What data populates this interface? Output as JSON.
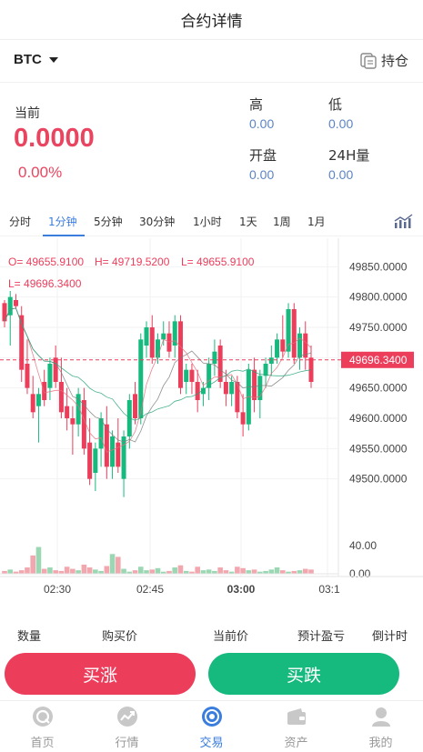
{
  "header": {
    "title": "合约详情"
  },
  "symbol": {
    "name": "BTC",
    "holdings_label": "持仓"
  },
  "price": {
    "current_label": "当前",
    "current": "0.0000",
    "change_pct": "0.00%",
    "high_label": "高",
    "high": "0.00",
    "low_label": "低",
    "low": "0.00",
    "open_label": "开盘",
    "open": "0.00",
    "volume_label": "24H量",
    "volume": "0.00"
  },
  "periods": [
    "分时",
    "1分钟",
    "5分钟",
    "30分钟",
    "1小时",
    "1天",
    "1周",
    "1月"
  ],
  "active_period": "1分钟",
  "chart_data": {
    "type": "candlestick",
    "ohlc_label": {
      "o": "O= 49655.9100",
      "h": "H= 49719.5200",
      "l": "L= 49655.9100",
      "c": "L= 49696.3400"
    },
    "y_ticks": [
      "49850.0000",
      "49800.0000",
      "49750.0000",
      "49700.0000",
      "49650.0000",
      "49600.0000",
      "49550.0000",
      "49500.0000"
    ],
    "ylim": [
      49450,
      49870
    ],
    "current_price_tag": "49696.3400",
    "current_price": 49696.34,
    "volume_ticks": [
      "40.00",
      "0.00"
    ],
    "x_ticks": [
      "02:30",
      "02:45",
      "03:00",
      "03:1"
    ],
    "candles": [
      [
        49790,
        49795,
        49750,
        49760
      ],
      [
        49770,
        49810,
        49720,
        49800
      ],
      [
        49795,
        49805,
        49780,
        49785
      ],
      [
        49770,
        49785,
        49660,
        49680
      ],
      [
        49690,
        49730,
        49640,
        49650
      ],
      [
        49640,
        49670,
        49600,
        49610
      ],
      [
        49620,
        49650,
        49560,
        49640
      ],
      [
        49660,
        49680,
        49620,
        49630
      ],
      [
        49650,
        49700,
        49630,
        49690
      ],
      [
        49700,
        49720,
        49650,
        49660
      ],
      [
        49660,
        49700,
        49600,
        49610
      ],
      [
        49620,
        49650,
        49580,
        49600
      ],
      [
        49600,
        49620,
        49540,
        49590
      ],
      [
        49590,
        49650,
        49570,
        49640
      ],
      [
        49630,
        49650,
        49540,
        49550
      ],
      [
        49560,
        49600,
        49490,
        49500
      ],
      [
        49510,
        49560,
        49480,
        49550
      ],
      [
        49550,
        49610,
        49520,
        49600
      ],
      [
        49590,
        49620,
        49500,
        49520
      ],
      [
        49520,
        49580,
        49500,
        49570
      ],
      [
        49560,
        49600,
        49510,
        49520
      ],
      [
        49500,
        49580,
        49470,
        49570
      ],
      [
        49570,
        49640,
        49550,
        49630
      ],
      [
        49640,
        49660,
        49590,
        49600
      ],
      [
        49600,
        49740,
        49590,
        49730
      ],
      [
        49720,
        49760,
        49700,
        49750
      ],
      [
        49750,
        49770,
        49690,
        49700
      ],
      [
        49700,
        49740,
        49690,
        49730
      ],
      [
        49730,
        49760,
        49720,
        49740
      ],
      [
        49740,
        49760,
        49700,
        49710
      ],
      [
        49720,
        49770,
        49700,
        49760
      ],
      [
        49760,
        49770,
        49640,
        49650
      ],
      [
        49660,
        49690,
        49640,
        49680
      ],
      [
        49680,
        49690,
        49640,
        49660
      ],
      [
        49660,
        49680,
        49610,
        49630
      ],
      [
        49640,
        49660,
        49620,
        49650
      ],
      [
        49650,
        49700,
        49630,
        49690
      ],
      [
        49690,
        49730,
        49670,
        49710
      ],
      [
        49720,
        49730,
        49650,
        49660
      ],
      [
        49660,
        49680,
        49620,
        49640
      ],
      [
        49640,
        49670,
        49620,
        49660
      ],
      [
        49660,
        49670,
        49600,
        49610
      ],
      [
        49610,
        49640,
        49570,
        49590
      ],
      [
        49590,
        49690,
        49580,
        49680
      ],
      [
        49680,
        49700,
        49610,
        49630
      ],
      [
        49630,
        49680,
        49600,
        49670
      ],
      [
        49670,
        49700,
        49650,
        49690
      ],
      [
        49690,
        49720,
        49670,
        49700
      ],
      [
        49700,
        49740,
        49690,
        49730
      ],
      [
        49730,
        49770,
        49700,
        49710
      ],
      [
        49710,
        49790,
        49700,
        49780
      ],
      [
        49780,
        49790,
        49690,
        49700
      ],
      [
        49700,
        49750,
        49680,
        49740
      ],
      [
        49740,
        49760,
        49680,
        49700
      ],
      [
        49700,
        49720,
        49650,
        49660
      ]
    ],
    "volumes": [
      4,
      6,
      3,
      5,
      9,
      26,
      38,
      7,
      9,
      5,
      4,
      10,
      7,
      5,
      13,
      9,
      6,
      4,
      11,
      28,
      24,
      7,
      3,
      5,
      10,
      5,
      6,
      8,
      3,
      4,
      9,
      12,
      4,
      3,
      10,
      5,
      6,
      4,
      9,
      5,
      3,
      10,
      8,
      5,
      6,
      3,
      4,
      6,
      9,
      5,
      3,
      4,
      5,
      7,
      6
    ],
    "colors": {
      "up": "#16b97e",
      "down": "#ec3d5b",
      "ma1": "#e5707e",
      "ma2": "#7c7c7c",
      "ma3": "#2aa57a"
    }
  },
  "table": {
    "headers": [
      "数量",
      "购买价",
      "当前价",
      "预计盈亏",
      "倒计时"
    ]
  },
  "actions": {
    "buy_up": "买涨",
    "buy_down": "买跌"
  },
  "tabs": [
    {
      "label": "首页",
      "icon": "home-icon"
    },
    {
      "label": "行情",
      "icon": "market-icon"
    },
    {
      "label": "交易",
      "icon": "trade-icon"
    },
    {
      "label": "资产",
      "icon": "wallet-icon"
    },
    {
      "label": "我的",
      "icon": "user-icon"
    }
  ],
  "active_tab": "交易"
}
